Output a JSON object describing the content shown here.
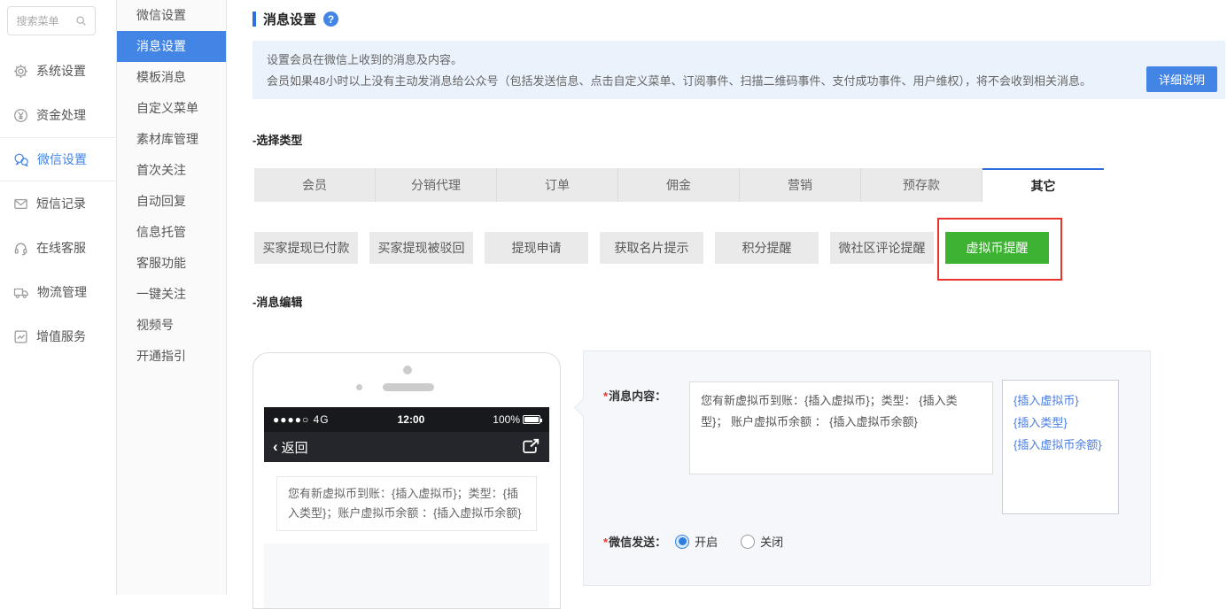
{
  "colors": {
    "accent_blue": "#4285e4",
    "title_blue": "#2d6fe0",
    "notice_bg": "#eaf2fb",
    "active_green": "#3db233",
    "highlight_red": "#e8342c",
    "link_blue": "#4a7de4"
  },
  "sidebar_primary": {
    "search_placeholder": "搜索菜单",
    "items": [
      {
        "label": "系统设置",
        "icon": "gear-icon",
        "active": false
      },
      {
        "label": "资金处理",
        "icon": "yen-circle-icon",
        "active": false
      },
      {
        "label": "微信设置",
        "icon": "wechat-icon",
        "active": true
      },
      {
        "label": "短信记录",
        "icon": "envelope-icon",
        "active": false
      },
      {
        "label": "在线客服",
        "icon": "headset-icon",
        "active": false
      },
      {
        "label": "物流管理",
        "icon": "truck-icon",
        "active": false
      },
      {
        "label": "增值服务",
        "icon": "chart-icon",
        "active": false
      }
    ]
  },
  "sidebar_secondary": {
    "items": [
      "微信设置",
      "消息设置",
      "模板消息",
      "自定义菜单",
      "素材库管理",
      "首次关注",
      "自动回复",
      "信息托管",
      "客服功能",
      "一键关注",
      "视频号",
      "开通指引"
    ],
    "active_item": "消息设置"
  },
  "header": {
    "title": "消息设置",
    "help_icon": "question-circle-icon"
  },
  "notice": {
    "line1": "设置会员在微信上收到的消息及内容。",
    "line2": "会员如果48小时以上没有主动发消息给公众号（包括发送信息、点击自定义菜单、订阅事件、扫描二维码事件、支付成功事件、用户维权），将不会收到相关消息。",
    "detail_button": "详细说明"
  },
  "type_section": {
    "heading": "-选择类型",
    "tabs": [
      "会员",
      "分销代理",
      "订单",
      "佣金",
      "营销",
      "预存款",
      "其它"
    ],
    "active_tab": "其它",
    "buttons": [
      "买家提现已付款",
      "买家提现被驳回",
      "提现申请",
      "获取名片提示",
      "积分提醒",
      "微社区评论提醒",
      "虚拟币提醒"
    ],
    "active_button": "虚拟币提醒"
  },
  "editor_section": {
    "heading": "-消息编辑",
    "phone": {
      "signal": "●●●●○ 4G",
      "time": "12:00",
      "battery": "100%",
      "back_label": "返回",
      "back_chevron": "‹",
      "share_icon": "share-icon",
      "message_preview": "您有新虚拟币到账：{插入虚拟币}；类型：{插入类型}；账户虚拟币余额 ：{插入虚拟币余额}"
    },
    "form": {
      "required_mark": "*",
      "content_label": "消息内容：",
      "content_value": "您有新虚拟币到账：{插入虚拟币}；类型： {插入类型}； 账户虚拟币余额 ： {插入虚拟币余额}",
      "insert_links": [
        "{插入虚拟币}",
        "{插入类型}",
        "{插入虚拟币余额}"
      ],
      "send_label": "微信发送：",
      "radio_on": "开启",
      "radio_off": "关闭",
      "selected_option": "开启"
    }
  }
}
